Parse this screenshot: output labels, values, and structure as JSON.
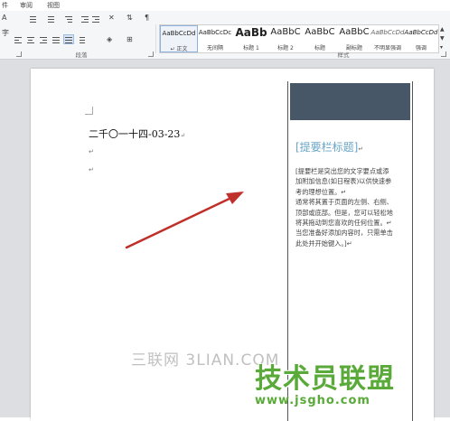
{
  "tabs": [
    {
      "label": "件"
    },
    {
      "label": "审阅"
    },
    {
      "label": "视图"
    }
  ],
  "ribbon": {
    "paragraph_group_label": "段落",
    "styles_group_label": "样式",
    "styles": [
      {
        "preview": "AaBbCcDd",
        "name": "↵ 正文",
        "selected": true
      },
      {
        "preview": "AaBbCcDc",
        "name": "无间隔",
        "selected": false
      },
      {
        "preview": "AaBb",
        "name": "标题 1",
        "selected": false
      },
      {
        "preview": "AaBbC",
        "name": "标题 2",
        "selected": false
      },
      {
        "preview": "AaBbC",
        "name": "标题",
        "selected": false
      },
      {
        "preview": "AaBbC",
        "name": "副标题",
        "selected": false
      },
      {
        "preview": "AaBbCcDd",
        "name": "不明显强调",
        "selected": false
      },
      {
        "preview": "AaBbCcDd",
        "name": "强调",
        "selected": false
      }
    ]
  },
  "document": {
    "date_text": "二千〇一十四-03-23",
    "pilcrow": "↵"
  },
  "sidebar": {
    "title": "[提要栏标题]",
    "title_mark": "↵",
    "body_lines": [
      "[提要栏是突出您的文字要点或添",
      "加附加信息(如日程表)以供快速参",
      "考的理想位置。↵",
      "通常将其置于页面的左侧、右侧、",
      "顶部或底部。但是，您可以轻松地",
      "将其拖动到您喜欢的任何位置。↵",
      "当您准备好添加内容时，只需单击",
      "此处并开始键入。]↵"
    ],
    "band_color": "#485768",
    "title_color": "#6aa5c7"
  },
  "annotation": {
    "arrow_color": "#c0302b"
  },
  "watermarks": {
    "sanlian": "三联网 3LIAN.COM",
    "jishuyuan": "技术员联盟",
    "jsgho": "www.jsgho.com",
    "jsgho_color": "#5aaa3a"
  }
}
